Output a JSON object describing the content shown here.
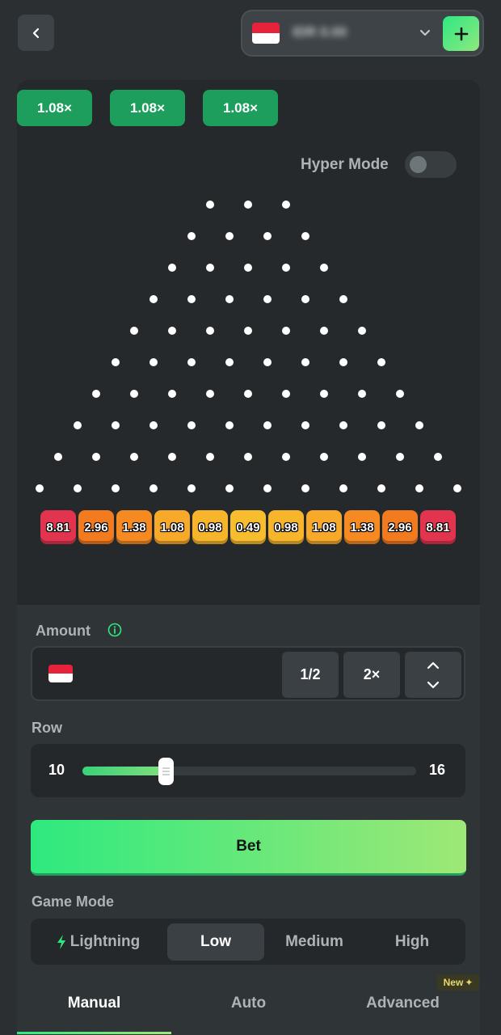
{
  "header": {
    "back_icon": "chevron-left-icon",
    "balance": "IDR 0.00",
    "add_icon": "plus-icon"
  },
  "recent_multipliers": [
    "1.08×",
    "1.08×",
    "1.08×"
  ],
  "hyper_mode": {
    "label": "Hyper Mode",
    "enabled": false
  },
  "board": {
    "rows": 10,
    "peg_color": "#ffffff",
    "multipliers": [
      {
        "value": "8.81",
        "color": "#e2344f"
      },
      {
        "value": "2.96",
        "color": "#f27a1f"
      },
      {
        "value": "1.38",
        "color": "#f58a22"
      },
      {
        "value": "1.08",
        "color": "#f7a92a"
      },
      {
        "value": "0.98",
        "color": "#f7b52c"
      },
      {
        "value": "0.49",
        "color": "#f7bd2e"
      },
      {
        "value": "0.98",
        "color": "#f7b52c"
      },
      {
        "value": "1.08",
        "color": "#f7a92a"
      },
      {
        "value": "1.38",
        "color": "#f58a22"
      },
      {
        "value": "2.96",
        "color": "#f27a1f"
      },
      {
        "value": "8.81",
        "color": "#e2344f"
      }
    ]
  },
  "amount": {
    "label": "Amount",
    "info_icon": "info-icon",
    "half_label": "1/2",
    "double_label": "2×",
    "stepper_icon": "chevron-updown-icon"
  },
  "row": {
    "label": "Row",
    "min": "10",
    "max": "16",
    "value_fraction": 0.25
  },
  "bet_label": "Bet",
  "game_mode": {
    "label": "Game Mode",
    "tabs": [
      "Lightning",
      "Low",
      "Medium",
      "High"
    ],
    "active": "Low",
    "lightning_icon": "lightning-icon"
  },
  "bottom_tabs": {
    "tabs": [
      "Manual",
      "Auto",
      "Advanced"
    ],
    "active": "Manual",
    "new_badge": "New"
  },
  "colors": {
    "accent_green": "#2ee97f",
    "badge_green": "#1e9e5c",
    "background": "#2b2f31"
  }
}
